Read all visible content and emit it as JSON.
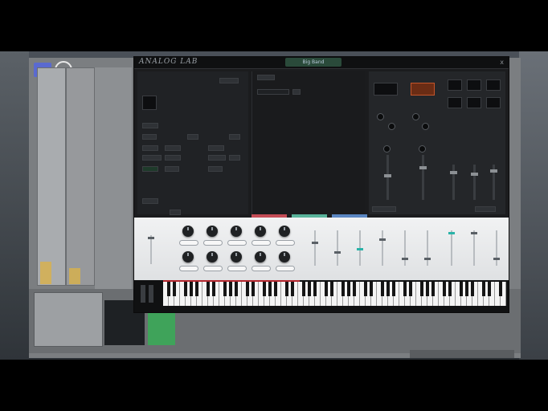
{
  "plugin": {
    "brand": "ANALOG LAB",
    "preset": "Big Band",
    "close": "x"
  },
  "controls": {
    "tabs": [
      "",
      "",
      ""
    ],
    "knob_labels_row1": [
      "",
      "",
      "",
      "",
      ""
    ],
    "knob_labels_row2": [
      "",
      "",
      "",
      "",
      ""
    ],
    "slider_count": 9
  },
  "colors": {
    "accent_teal": "#2ab3a8",
    "keyboard_red": "#b3262e",
    "preset_green": "#2a4a3a"
  }
}
